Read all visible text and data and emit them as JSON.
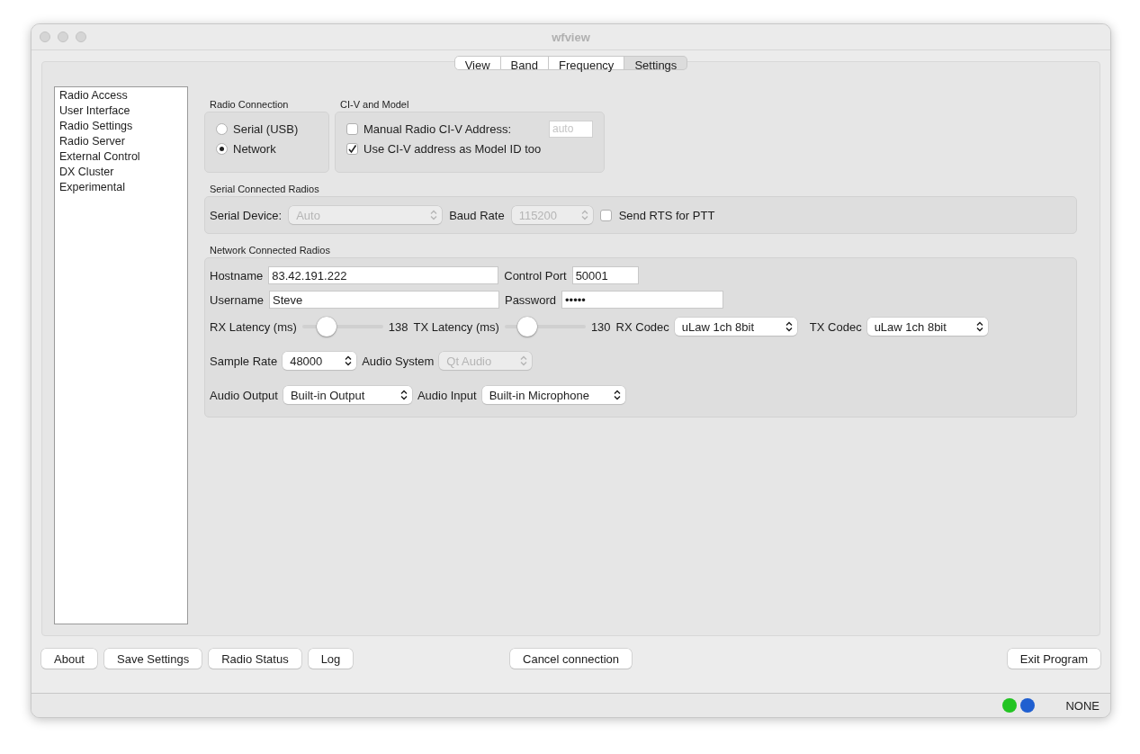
{
  "window": {
    "title": "wfview"
  },
  "tabs": [
    {
      "label": "View",
      "selected": false
    },
    {
      "label": "Band",
      "selected": false
    },
    {
      "label": "Frequency",
      "selected": false
    },
    {
      "label": "Settings",
      "selected": true
    }
  ],
  "sidebar": {
    "items": [
      {
        "label": "Radio Access",
        "selected": false
      },
      {
        "label": "User Interface",
        "selected": false
      },
      {
        "label": "Radio Settings",
        "selected": false
      },
      {
        "label": "Radio Server",
        "selected": false
      },
      {
        "label": "External Control",
        "selected": false
      },
      {
        "label": "DX Cluster",
        "selected": false
      },
      {
        "label": "Experimental",
        "selected": false
      }
    ]
  },
  "radio_connection": {
    "title": "Radio Connection",
    "options": [
      {
        "label": "Serial (USB)",
        "selected": false
      },
      {
        "label": "Network",
        "selected": true
      }
    ]
  },
  "civ_model": {
    "title": "CI-V and Model",
    "manual_address": {
      "label": "Manual Radio CI-V Address:",
      "checked": false,
      "placeholder": "auto"
    },
    "use_as_model": {
      "label": "Use CI-V address as Model ID too",
      "checked": true
    }
  },
  "serial": {
    "title": "Serial Connected Radios",
    "device": {
      "label": "Serial Device:",
      "value": "Auto",
      "disabled": true
    },
    "baud": {
      "label": "Baud Rate",
      "value": "115200",
      "disabled": true
    },
    "rts": {
      "label": "Send RTS for PTT",
      "checked": false
    }
  },
  "network": {
    "title": "Network Connected Radios",
    "hostname": {
      "label": "Hostname",
      "value": "83.42.191.222"
    },
    "control_port": {
      "label": "Control Port",
      "value": "50001"
    },
    "username": {
      "label": "Username",
      "value": "Steve"
    },
    "password": {
      "label": "Password",
      "value": "•••••"
    },
    "rx_latency": {
      "label": "RX Latency (ms)",
      "level": 0.3,
      "reading": "138"
    },
    "tx_latency": {
      "label": "TX Latency (ms)",
      "level": 0.28,
      "reading": "130"
    },
    "rx_codec": {
      "label": "RX Codec",
      "value": "uLaw 1ch 8bit",
      "disabled": false
    },
    "tx_codec": {
      "label": "TX Codec",
      "value": "uLaw 1ch 8bit",
      "disabled": false
    },
    "sample_rate": {
      "label": "Sample Rate",
      "value": "48000",
      "disabled": false
    },
    "audio_system": {
      "label": "Audio System",
      "value": "Qt Audio",
      "disabled": true
    },
    "audio_output": {
      "label": "Audio Output",
      "value": "Built-in Output",
      "disabled": false
    },
    "audio_input": {
      "label": "Audio Input",
      "value": "Built-in Microphone",
      "disabled": false
    }
  },
  "footer": {
    "left_buttons": [
      "About",
      "Save Settings",
      "Radio Status",
      "Log"
    ],
    "center_button": "Cancel connection",
    "right_button": "Exit Program"
  },
  "status_bar": {
    "indicators": [
      {
        "color": "#22c422"
      },
      {
        "color": "#1f5fd0"
      }
    ],
    "text": "NONE"
  }
}
